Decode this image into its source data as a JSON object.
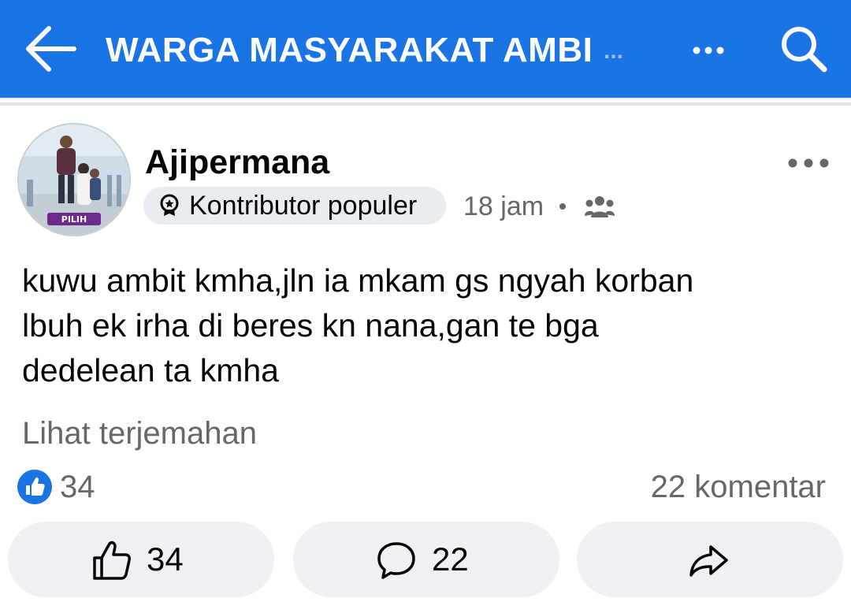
{
  "header": {
    "title": "WARGA MASYARAKAT AMBI",
    "ellipsis": "...",
    "back_icon": "arrow-left-icon",
    "more_icon": "more-horizontal-icon",
    "search_icon": "search-icon",
    "bar_color": "#1b74e4"
  },
  "post": {
    "author": "Ajipermana",
    "avatar_label": "PILIH",
    "badge": {
      "label": "Kontributor populer",
      "icon": "award-badge-icon"
    },
    "timestamp": "18 jam",
    "separator": "•",
    "audience_icon": "group-members-icon",
    "more_icon": "more-horizontal-icon",
    "text_lines": [
      "kuwu ambit kmha,jln ia mkam gs ngyah korban",
      "lbuh ek irha di beres kn nana,gan te bga",
      "dedelean ta kmha"
    ],
    "see_translation": "Lihat terjemahan",
    "reactions": {
      "icon": "like-reaction-icon",
      "count": "34"
    },
    "comments_summary": "22 komentar",
    "actions": {
      "like": {
        "icon": "thumbs-up-icon",
        "count": "34"
      },
      "comment": {
        "icon": "comment-bubble-icon",
        "count": "22"
      },
      "share": {
        "icon": "share-arrow-icon"
      }
    }
  }
}
